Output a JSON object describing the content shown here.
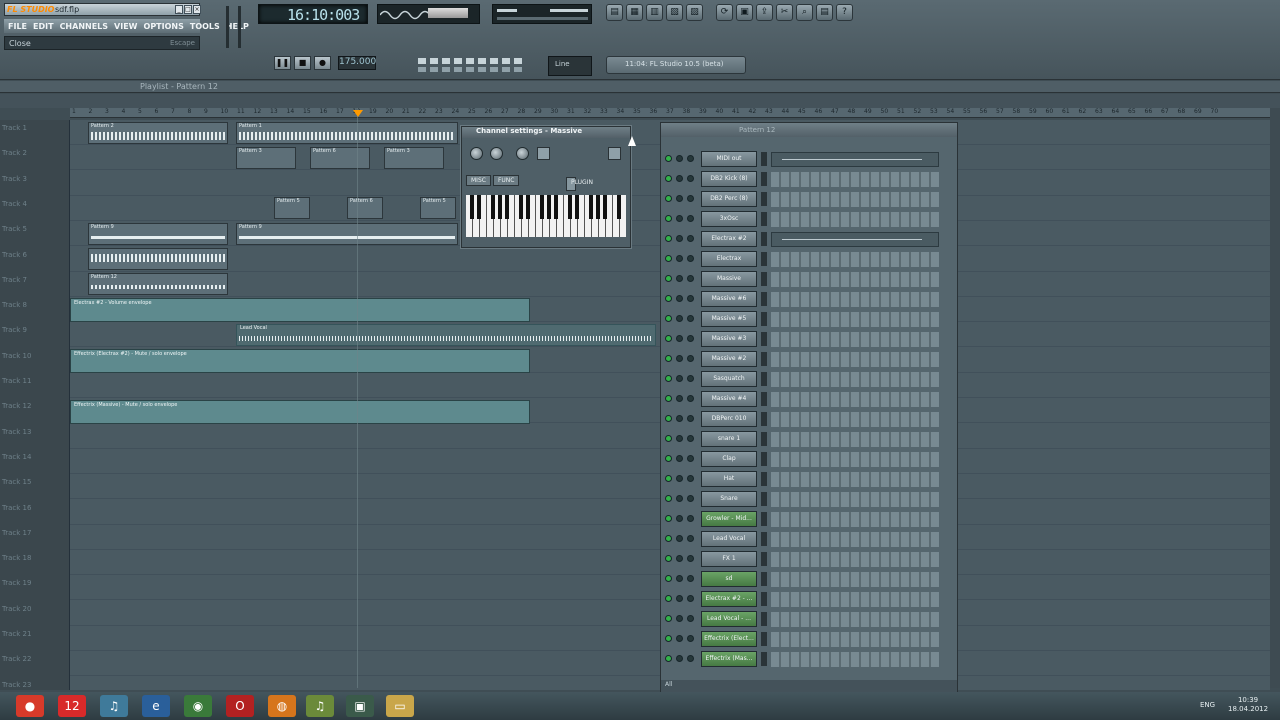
{
  "app": {
    "logo": "FL STUDIO",
    "file": "sdf.flp"
  },
  "menu": [
    "FILE",
    "EDIT",
    "CHANNELS",
    "VIEW",
    "OPTIONS",
    "TOOLS",
    "HELP"
  ],
  "hint": {
    "left": "Close",
    "right": "Escape"
  },
  "time": "16:10:003",
  "tempo": "175.000",
  "pattern_sel": "Line",
  "hint_panel": "11:04: FL Studio 10.5 (beta)",
  "playlist": {
    "title": "Playlist - Pattern 12"
  },
  "ruler": [
    "1",
    "2",
    "3",
    "4",
    "5",
    "6",
    "7",
    "8",
    "9",
    "10",
    "11",
    "12",
    "13",
    "14",
    "15",
    "16",
    "17",
    "18",
    "19",
    "20",
    "21",
    "22",
    "23",
    "24",
    "25",
    "26",
    "27",
    "28",
    "29",
    "30",
    "31",
    "32",
    "33",
    "34",
    "35",
    "36",
    "37",
    "38",
    "39",
    "40",
    "41",
    "42",
    "43",
    "44",
    "45",
    "46",
    "47",
    "48",
    "49",
    "50",
    "51",
    "52",
    "53",
    "54",
    "55",
    "56",
    "57",
    "58",
    "59",
    "60",
    "61",
    "62",
    "63",
    "64",
    "65",
    "66",
    "67",
    "68",
    "69",
    "70"
  ],
  "tracks": [
    "Track 1",
    "Track 2",
    "Track 3",
    "Track 4",
    "Track 5",
    "Track 6",
    "Track 7",
    "Track 8",
    "Track 9",
    "Track 10",
    "Track 11",
    "Track 12",
    "Track 13",
    "Track 14",
    "Track 15",
    "Track 16",
    "Track 17",
    "Track 18",
    "Track 19",
    "Track 20",
    "Track 21",
    "Track 22",
    "Track 23"
  ],
  "clips": {
    "p1": "Pattern 1",
    "p2": "Pattern 2",
    "p3": "Pattern 3",
    "p5": "Pattern 5",
    "p6": "Pattern 6",
    "p9": "Pattern 9",
    "p12": "Pattern 12",
    "auto1": "Electrax #2 - Volume envelope",
    "auto2": "Effectrix (Electrax #2) - Mute / solo envelope",
    "auto3": "Effectrix (Massive) - Mute / solo envelope",
    "vocal": "Lead Vocal"
  },
  "channel_settings": {
    "title": "Channel settings - Massive",
    "tabs": [
      "PLUGIN",
      "MISC",
      "FUNC"
    ]
  },
  "step_seq": {
    "title": "Pattern 12",
    "footer": "All",
    "channels": [
      {
        "name": "MIDI out",
        "type": "piano",
        "green": false
      },
      {
        "name": "DB2 Kick (8)",
        "type": "steps",
        "green": false
      },
      {
        "name": "DB2 Perc (8)",
        "type": "steps",
        "green": false
      },
      {
        "name": "3xOsc",
        "type": "steps",
        "green": false
      },
      {
        "name": "Electrax #2",
        "type": "piano",
        "green": false
      },
      {
        "name": "Electrax",
        "type": "steps",
        "green": false
      },
      {
        "name": "Massive",
        "type": "steps",
        "green": false
      },
      {
        "name": "Massive #6",
        "type": "steps",
        "green": false
      },
      {
        "name": "Massive #5",
        "type": "steps",
        "green": false
      },
      {
        "name": "Massive #3",
        "type": "steps",
        "green": false
      },
      {
        "name": "Massive #2",
        "type": "steps",
        "green": false
      },
      {
        "name": "Sasquatch",
        "type": "steps",
        "green": false
      },
      {
        "name": "Massive #4",
        "type": "steps",
        "green": false
      },
      {
        "name": "DBPerc 010",
        "type": "steps",
        "green": false
      },
      {
        "name": "snare 1",
        "type": "steps",
        "green": false
      },
      {
        "name": "Clap",
        "type": "steps",
        "green": false
      },
      {
        "name": "Hat",
        "type": "steps",
        "green": false
      },
      {
        "name": "Snare",
        "type": "steps",
        "green": false
      },
      {
        "name": "Growler - Mid...",
        "type": "steps",
        "green": true
      },
      {
        "name": "Lead Vocal",
        "type": "steps",
        "green": false
      },
      {
        "name": "FX 1",
        "type": "steps",
        "green": false
      },
      {
        "name": "sd",
        "type": "steps",
        "green": true
      },
      {
        "name": "Electrax #2 - ...",
        "type": "steps",
        "green": true
      },
      {
        "name": "Lead Vocal - ...",
        "type": "steps",
        "green": true
      },
      {
        "name": "Effectrix (Elect...",
        "type": "steps",
        "green": true
      },
      {
        "name": "Effectrix (Mas...",
        "type": "steps",
        "green": true
      }
    ]
  },
  "taskbar": {
    "lang": "ENG",
    "time": "10:39",
    "date": "18.04.2012"
  }
}
